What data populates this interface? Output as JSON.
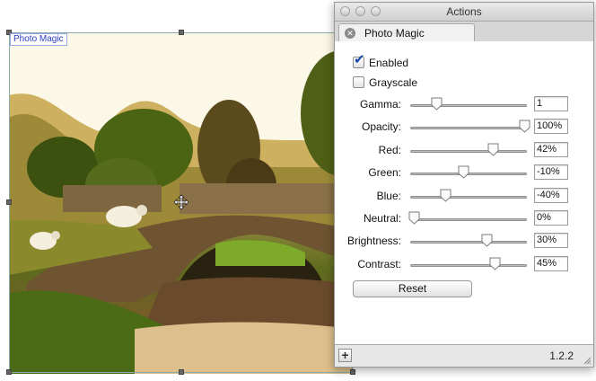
{
  "canvas": {
    "layer_label": "Photo Magic"
  },
  "panel": {
    "window_title": "Actions",
    "tab_label": "Photo Magic",
    "enabled": {
      "label": "Enabled",
      "checked": true
    },
    "grayscale": {
      "label": "Grayscale",
      "checked": false
    },
    "sliders": [
      {
        "label": "Gamma:",
        "value": "1",
        "position": 0.22
      },
      {
        "label": "Opacity:",
        "value": "100%",
        "position": 0.98
      },
      {
        "label": "Red:",
        "value": "42%",
        "position": 0.71
      },
      {
        "label": "Green:",
        "value": "-10%",
        "position": 0.45
      },
      {
        "label": "Blue:",
        "value": "-40%",
        "position": 0.3
      },
      {
        "label": "Neutral:",
        "value": "0%",
        "position": 0.03
      },
      {
        "label": "Brightness:",
        "value": "30%",
        "position": 0.65
      },
      {
        "label": "Contrast:",
        "value": "45%",
        "position": 0.72
      }
    ],
    "reset_label": "Reset",
    "add_icon": "+",
    "version": "1.2.2"
  },
  "icons": {
    "close": "close-icon",
    "checkmark": "checkmark-icon",
    "move_cursor": "move-cursor-icon",
    "plus": "plus-icon",
    "resize": "resize-grip-icon"
  },
  "colors": {
    "checkmark": "#1a48a6",
    "layer_label": "#2a3fc4"
  }
}
